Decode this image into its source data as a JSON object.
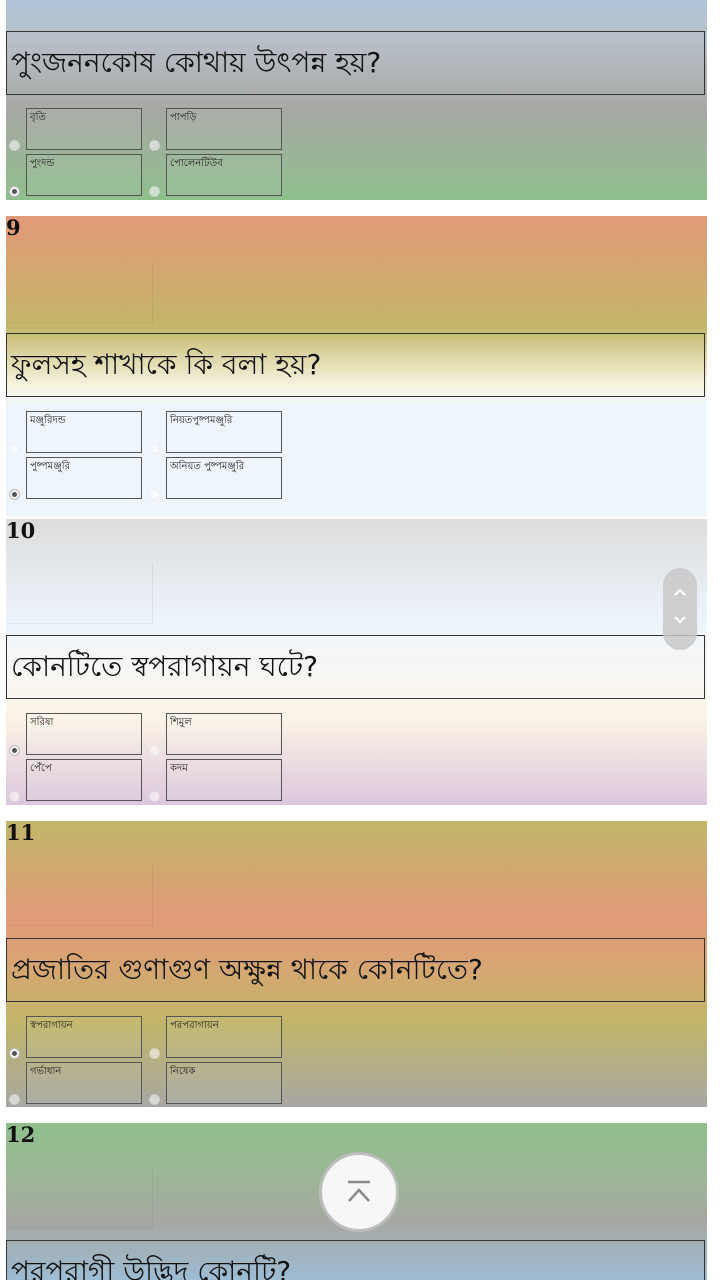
{
  "questions": [
    {
      "number": "",
      "text": "পুংজননকোষ কোথায় উৎপন্ন হয়?",
      "options": [
        "বৃতি",
        "পাপড়ি",
        "পুংদন্ড",
        "পোলেনটিউব"
      ],
      "selected_index": 2
    },
    {
      "number": "9",
      "text": "ফুলসহ শাখাকে কি বলা হয়?",
      "options": [
        "মঞ্জুরিদন্ড",
        "নিয়তপুষ্পমঞ্জুরি",
        "পুষ্পমঞ্জুরি",
        "অনিয়ত পুষ্পমঞ্জুরি"
      ],
      "selected_index": 2
    },
    {
      "number": "10",
      "text": "কোনটিতে স্বপরাগায়ন ঘটে?",
      "options": [
        "সরিষা",
        "শিমুল",
        "পেঁপে",
        "কদম"
      ],
      "selected_index": 0
    },
    {
      "number": "11",
      "text": "প্রজাতির গুণাগুণ অক্ষুন্ন থাকে কোনটিতে?",
      "options": [
        "স্বপরাগায়ন",
        "পরপরাগায়ন",
        "গর্ভাধান",
        "নিষেক"
      ],
      "selected_index": 0
    },
    {
      "number": "12",
      "text": "পরপরাগী উদ্ভিদ কোনটি?",
      "options": [],
      "selected_index": -1
    }
  ],
  "controls": {
    "scroll_handle_up_icon": "chevron-up-icon",
    "scroll_handle_down_icon": "chevron-down-icon",
    "scroll_to_top_icon": "double-chevron-up-icon"
  },
  "colors": {
    "green": "#8fbf8c",
    "salmon": "#e29a78",
    "olive": "#c2b668",
    "light_blue": "#eef5fc",
    "light_gray": "#dcdcdc",
    "cream": "#fbf3e6",
    "lavender": "#dbc6dc",
    "slate_blue": "#9cbcd4",
    "gray": "#a7a7a3"
  }
}
